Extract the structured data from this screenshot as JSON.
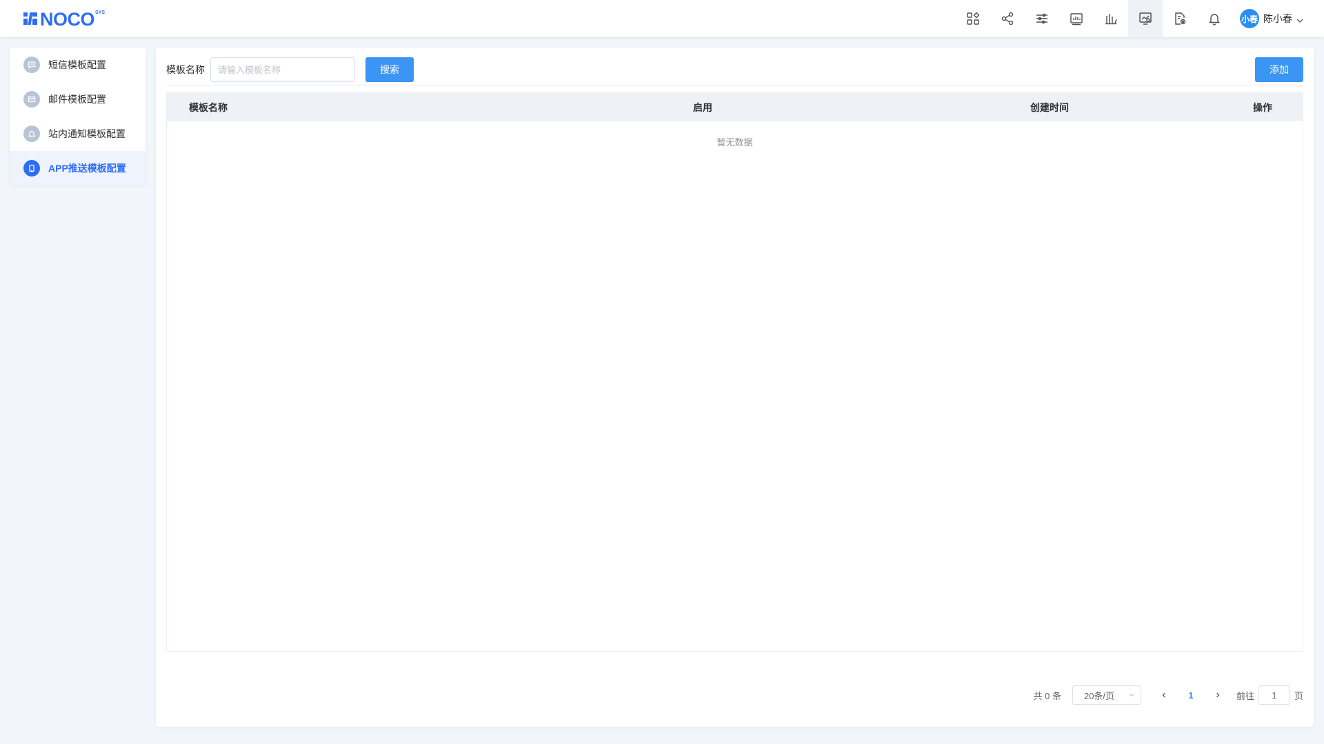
{
  "app": {
    "logo_text": "NOCO",
    "logo_sup": "SYS",
    "brand_color": "#2d6df6"
  },
  "header": {
    "icons": [
      "apps-icon",
      "share-icon",
      "sliders-icon",
      "report-icon",
      "chart-icon",
      "monitor-icon",
      "document-settings-icon",
      "bell-icon"
    ],
    "active_icon_index": 5,
    "user": {
      "avatar_text": "小春",
      "name": "陈小春"
    }
  },
  "sidebar": {
    "items": [
      {
        "label": "短信模板配置",
        "icon": "message-icon",
        "active": false
      },
      {
        "label": "邮件模板配置",
        "icon": "mail-icon",
        "active": false
      },
      {
        "label": "站内通知模板配置",
        "icon": "bell-icon",
        "active": false
      },
      {
        "label": "APP推送模板配置",
        "icon": "phone-icon",
        "active": true
      }
    ]
  },
  "toolbar": {
    "filter_label": "模板名称",
    "filter_placeholder": "请输入模板名称",
    "filter_value": "",
    "search_label": "搜索",
    "add_label": "添加"
  },
  "table": {
    "columns": [
      "模板名称",
      "启用",
      "创建时间",
      "操作"
    ],
    "rows": [],
    "empty_text": "暂无数据"
  },
  "pagination": {
    "total_text": "共 0 条",
    "page_size": "20条/页",
    "current_page": "1",
    "goto_label": "前往",
    "goto_value": "1",
    "page_suffix": "页"
  }
}
